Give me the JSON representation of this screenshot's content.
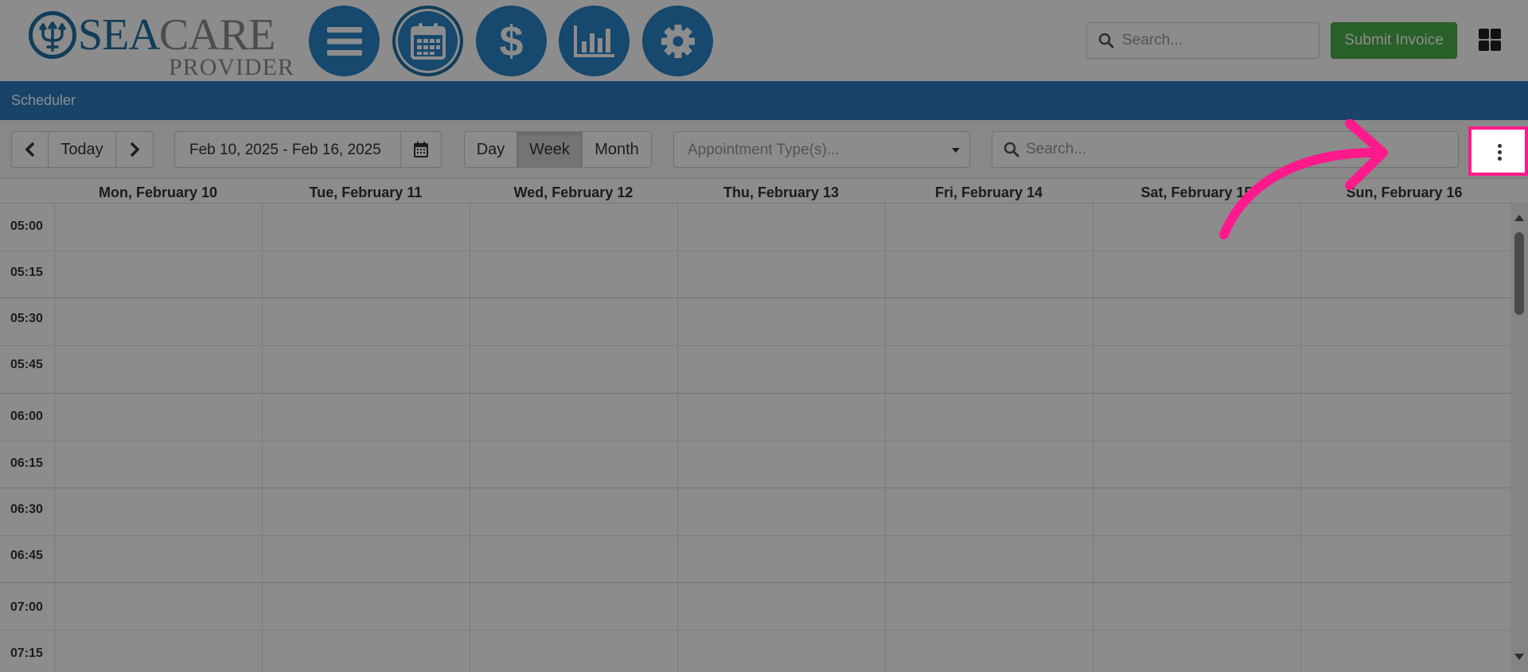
{
  "app": {
    "logo_sea": "SEA",
    "logo_care": "CARE",
    "logo_provider": "PROVIDER"
  },
  "nav": [
    {
      "name": "menu",
      "icon": "hamburger-menu-icon"
    },
    {
      "name": "scheduler",
      "icon": "calendar-icon",
      "active": true
    },
    {
      "name": "billing",
      "icon": "dollar-icon",
      "label": "$"
    },
    {
      "name": "reports",
      "icon": "bar-chart-icon"
    },
    {
      "name": "settings",
      "icon": "gear-icon"
    }
  ],
  "header": {
    "search_placeholder": "Search...",
    "submit_invoice_label": "Submit Invoice",
    "apps_icon": "grid-icon"
  },
  "page": {
    "title": "Scheduler"
  },
  "toolbar": {
    "today_label": "Today",
    "date_range": "Feb 10, 2025 - Feb 16, 2025",
    "views": [
      "Day",
      "Week",
      "Month"
    ],
    "active_view": "Week",
    "appointment_type_placeholder": "Appointment Type(s)...",
    "search_placeholder": "Search..."
  },
  "calendar": {
    "days": [
      "Mon, February 10",
      "Tue, February 11",
      "Wed, February 12",
      "Thu, February 13",
      "Fri, February 14",
      "Sat, February 15",
      "Sun, February 16"
    ],
    "times": [
      "05:00",
      "05:15",
      "05:30",
      "05:45",
      "06:00",
      "06:15",
      "06:30",
      "06:45",
      "07:00",
      "07:15"
    ]
  },
  "colors": {
    "brand_blue": "#2b84c6",
    "title_bar": "#2f7bbf",
    "submit_green": "#4cae4c",
    "highlight_pink": "#ff1a8c"
  }
}
